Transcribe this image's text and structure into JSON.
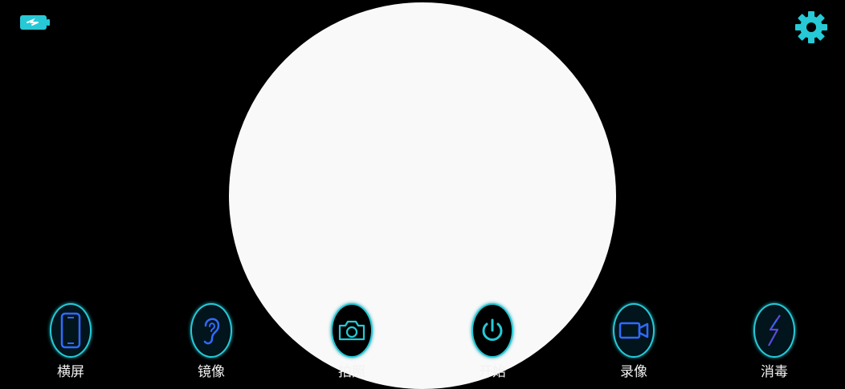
{
  "status": {
    "battery_icon": "battery-charging-icon",
    "settings_icon": "gear-icon"
  },
  "colors": {
    "background": "#000000",
    "accent": "#27c9d6",
    "icon_blue": "#2f6bff",
    "viewfinder": "#f9f9f9",
    "label": "#f2f2f2"
  },
  "toolbar": {
    "items": [
      {
        "label": "横屏",
        "icon": "phone-landscape-icon"
      },
      {
        "label": "镜像",
        "icon": "ear-icon"
      },
      {
        "label": "拍照",
        "icon": "camera-icon"
      },
      {
        "label": "开始",
        "icon": "power-icon"
      },
      {
        "label": "录像",
        "icon": "video-camera-icon"
      },
      {
        "label": "消毒",
        "icon": "lightning-icon"
      }
    ]
  }
}
